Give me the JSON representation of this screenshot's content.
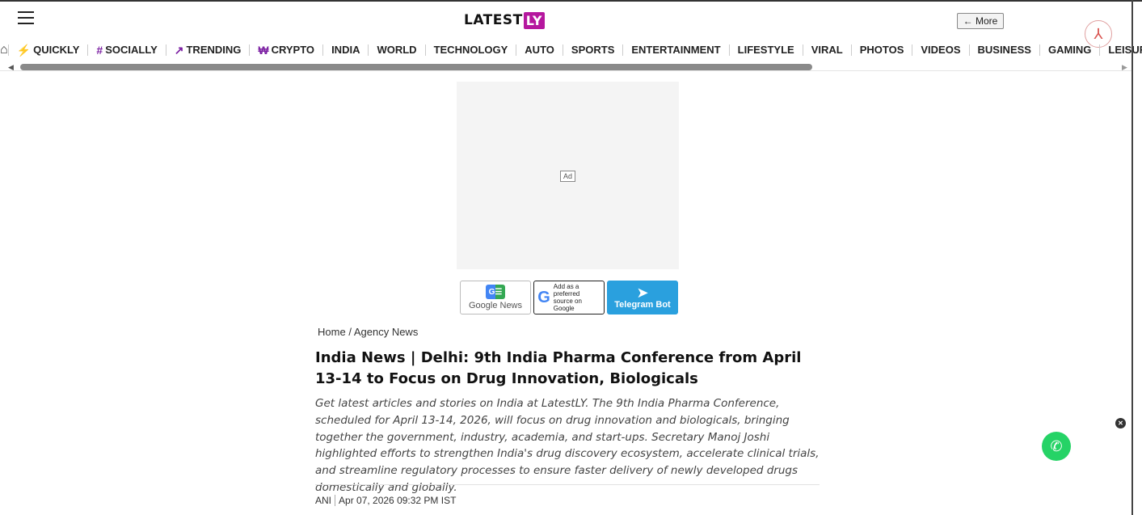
{
  "header": {
    "logo_main": "LATEST",
    "logo_accent": "LY",
    "more_button": "← More"
  },
  "nav": {
    "items": [
      {
        "label": "QUICKLY",
        "icon": "bolt-icon",
        "glyph": "⚡"
      },
      {
        "label": "SOCIALLY",
        "icon": "hash-icon",
        "glyph": "#"
      },
      {
        "label": "TRENDING",
        "icon": "trending-icon",
        "glyph": "↗"
      },
      {
        "label": "CRYPTO",
        "icon": "crypto-icon",
        "glyph": "₩"
      },
      {
        "label": "INDIA"
      },
      {
        "label": "WORLD"
      },
      {
        "label": "TECHNOLOGY"
      },
      {
        "label": "AUTO"
      },
      {
        "label": "SPORTS"
      },
      {
        "label": "ENTERTAINMENT"
      },
      {
        "label": "LIFESTYLE"
      },
      {
        "label": "VIRAL"
      },
      {
        "label": "PHOTOS"
      },
      {
        "label": "VIDEOS"
      },
      {
        "label": "BUSINESS"
      },
      {
        "label": "GAMING"
      },
      {
        "label": "LEISURELY"
      }
    ]
  },
  "ad": {
    "label": "Ad"
  },
  "badges": {
    "google_news": "Google News",
    "google_pref": "Add as a preferred source on Google",
    "telegram": "Telegram Bot"
  },
  "breadcrumb": {
    "home": "Home",
    "separator": "/",
    "section": "Agency News"
  },
  "article": {
    "headline": "India News | Delhi: 9th India Pharma Conference from April 13-14 to Focus on Drug Innovation, Biologicals",
    "summary": "Get latest articles and stories on India at LatestLY. The 9th India Pharma Conference, scheduled for April 13-14, 2026, will focus on drug innovation and biologicals, bringing together the government, industry, academia, and start-ups. Secretary Manoj Joshi highlighted efforts to strengthen India's drug discovery ecosystem, accelerate clinical trials, and streamline regulatory processes to ensure faster delivery of newly developed drugs domestically and globally.",
    "source": "ANI",
    "timestamp": "Apr 07, 2026 09:32 PM IST"
  },
  "colors": {
    "brand_accent": "#b5179e",
    "telegram": "#2aa0de",
    "whatsapp": "#25d366"
  }
}
